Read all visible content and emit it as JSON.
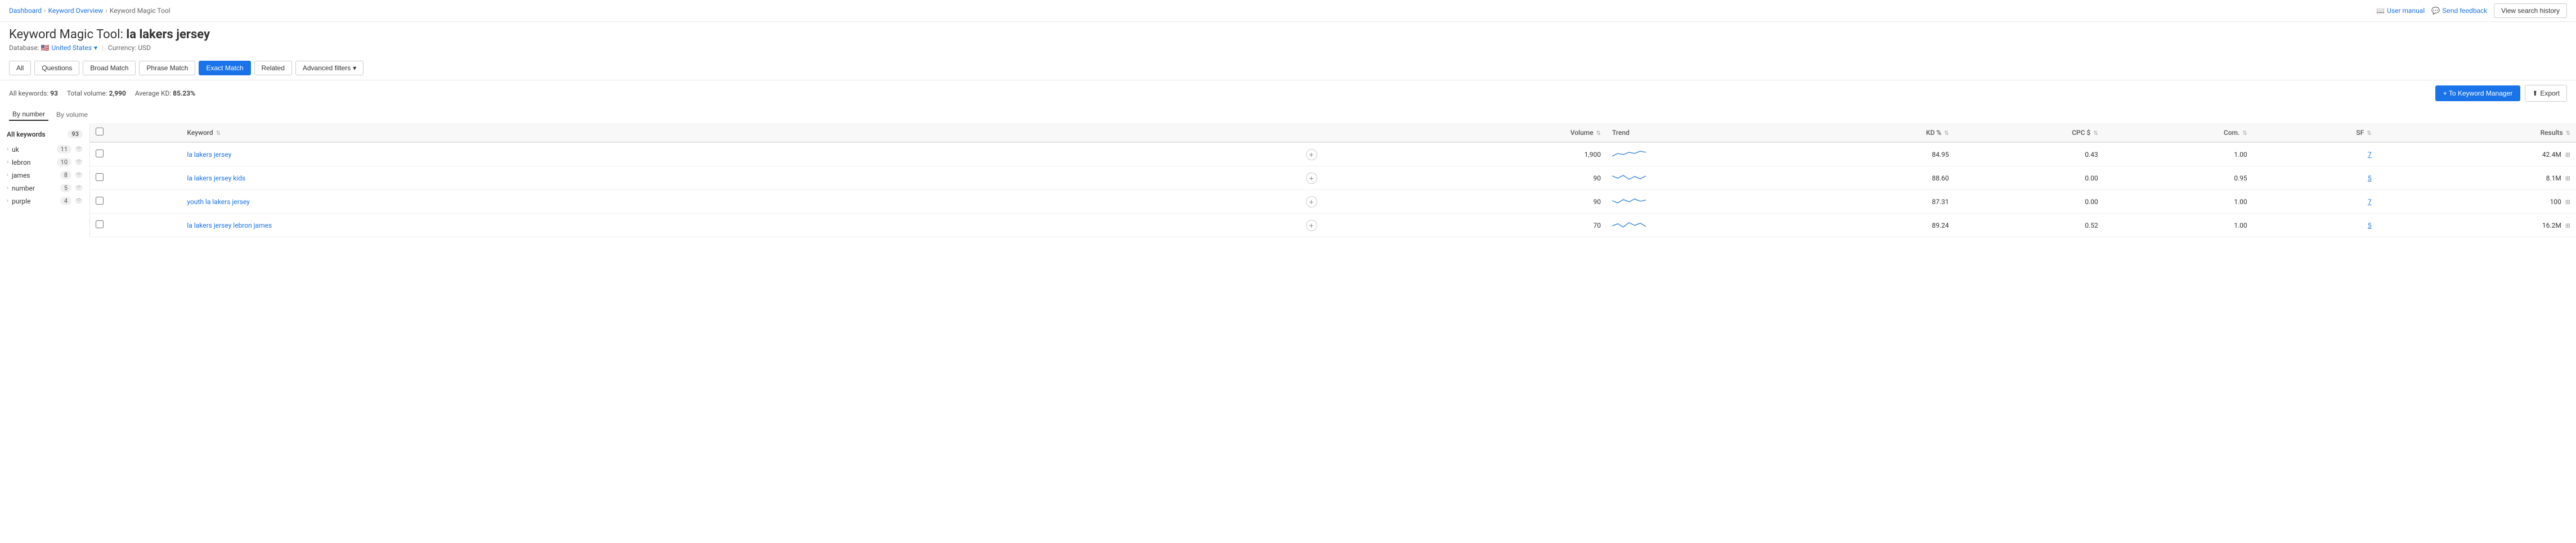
{
  "breadcrumb": {
    "items": [
      "Dashboard",
      "Keyword Overview",
      "Keyword Magic Tool"
    ]
  },
  "top_actions": {
    "user_manual": "User manual",
    "feedback": "Send feedback",
    "view_history": "View search history"
  },
  "title": {
    "prefix": "Keyword Magic Tool:",
    "query": "la lakers jersey"
  },
  "subtitle": {
    "database_label": "Database:",
    "database_value": "United States",
    "currency_label": "Currency: USD"
  },
  "filter_tabs": [
    {
      "label": "All",
      "active": false
    },
    {
      "label": "Questions",
      "active": false
    },
    {
      "label": "Broad Match",
      "active": false
    },
    {
      "label": "Phrase Match",
      "active": false
    },
    {
      "label": "Exact Match",
      "active": true
    },
    {
      "label": "Related",
      "active": false
    }
  ],
  "advanced_filters": "Advanced filters",
  "stats": {
    "all_keywords_label": "All keywords:",
    "all_keywords_value": "93",
    "total_volume_label": "Total volume:",
    "total_volume_value": "2,990",
    "avg_kd_label": "Average KD:",
    "avg_kd_value": "85.23%"
  },
  "actions": {
    "to_keyword_manager": "+ To Keyword Manager",
    "export": "Export"
  },
  "view_toggle": {
    "by_number": "By number",
    "by_volume": "By volume"
  },
  "sidebar": {
    "header": "All keywords",
    "count": "93",
    "items": [
      {
        "label": "uk",
        "count": "11"
      },
      {
        "label": "lebron",
        "count": "10"
      },
      {
        "label": "james",
        "count": "8"
      },
      {
        "label": "number",
        "count": "5"
      },
      {
        "label": "purple",
        "count": "4"
      }
    ]
  },
  "table": {
    "columns": [
      "Keyword",
      "Volume",
      "Trend",
      "KD %",
      "CPC $",
      "Com.",
      "SF",
      "Results"
    ],
    "rows": [
      {
        "keyword": "la lakers jersey",
        "volume": "1,900",
        "kd": "84.95",
        "cpc": "0.43",
        "com": "1.00",
        "sf": "7",
        "results": "42.4M"
      },
      {
        "keyword": "la lakers jersey kids",
        "volume": "90",
        "kd": "88.60",
        "cpc": "0.00",
        "com": "0.95",
        "sf": "5",
        "results": "8.1M"
      },
      {
        "keyword": "youth la lakers jersey",
        "volume": "90",
        "kd": "87.31",
        "cpc": "0.00",
        "com": "1.00",
        "sf": "7",
        "results": "100"
      },
      {
        "keyword": "la lakers jersey lebron james",
        "volume": "70",
        "kd": "89.24",
        "cpc": "0.52",
        "com": "1.00",
        "sf": "5",
        "results": "16.2M"
      }
    ]
  }
}
